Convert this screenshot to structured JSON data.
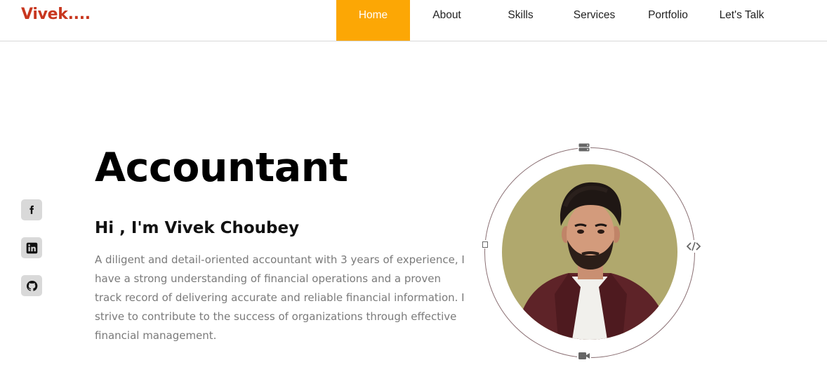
{
  "brand": {
    "logo": "Vivek....",
    "color": "#c8371f"
  },
  "nav": {
    "accent": "#fca705",
    "items": [
      {
        "label": "Home",
        "active": true
      },
      {
        "label": "About",
        "active": false
      },
      {
        "label": "Skills",
        "active": false
      },
      {
        "label": "Services",
        "active": false
      },
      {
        "label": "Portfolio",
        "active": false
      },
      {
        "label": "Let's Talk",
        "active": false
      }
    ]
  },
  "socials": [
    {
      "icon": "facebook-icon"
    },
    {
      "icon": "linkedin-icon"
    },
    {
      "icon": "github-icon"
    }
  ],
  "hero": {
    "title": "Accountant",
    "greeting": "Hi , I'm Vivek Choubey",
    "description": "A diligent and detail-oriented accountant with 3 years of experience, I have a strong understanding of financial operations and a proven track record of delivering accurate and reliable financial information. I strive to contribute to the success of organizations through effective financial management."
  },
  "profile": {
    "photo_background": "#b0a86d",
    "orbit_icons": [
      "server-icon",
      "code-icon",
      "video-icon",
      "square-icon"
    ]
  }
}
